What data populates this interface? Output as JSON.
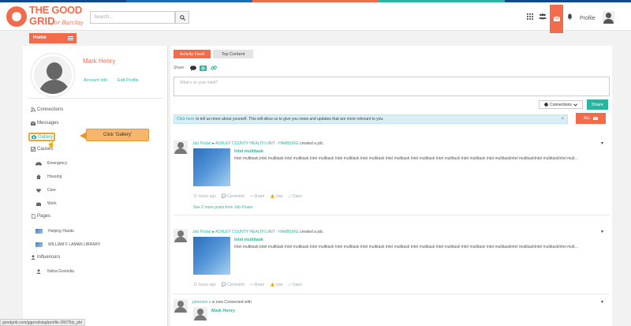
{
  "colors": {
    "brand": "#f26b4a",
    "accent": "#2bb5a0",
    "stripe": [
      "#0e4a8a",
      "#1d6bb3",
      "#f26b4a",
      "#2bb5a0",
      "#0e4a8a"
    ]
  },
  "logo": {
    "line1": "THE GOOD",
    "line2": "GRID",
    "tagline": "for Barclay"
  },
  "search": {
    "placeholder": "Search...",
    "icon": "search-icon"
  },
  "header": {
    "icons": [
      "grid-icon",
      "users-icon",
      "envelope-icon",
      "bell-icon"
    ],
    "profile_label": "Profile"
  },
  "home": {
    "label": "Home"
  },
  "sidebar": {
    "name": "Mark Henry",
    "account_info": "Account Info",
    "edit_profile": "Edit Profile",
    "connections": "Connections",
    "messages": "Messages",
    "gallery": "Gallery",
    "causes": "Causes",
    "cause_items": [
      {
        "label": "Emergency",
        "icon": "car-icon"
      },
      {
        "label": "Housing",
        "icon": "home-icon"
      },
      {
        "label": "Care",
        "icon": "heart-icon"
      },
      {
        "label": "Work",
        "icon": "briefcase-icon"
      }
    ],
    "pages": "Pages",
    "page_items": [
      "Helping Hands",
      "WILLIAM F LAMAN LIBRARY"
    ],
    "influencers": "Influencers",
    "influencer_items": [
      "Nisha Govindia"
    ]
  },
  "callout": {
    "text": "Click 'Gallery'"
  },
  "tabs": {
    "activity": "Activity Feed",
    "top": "Top Content"
  },
  "composer": {
    "share_label": "Share :",
    "placeholder": "What's on your mind?",
    "connections_btn": "Connections",
    "share_btn": "Share"
  },
  "notice": {
    "link": "Click here",
    "text": "to tell us more about yourself. This will allow us to give you news and updates that are more relevant to you.",
    "close": "×"
  },
  "filter": {
    "label": "ALL"
  },
  "posts": [
    {
      "author": "Job Poster",
      "arrow": "▸",
      "org": "ASHLEY COUNTY HEALTH UNIT - HAMBURG",
      "action": "created a job.",
      "title": "Intel multitask",
      "text": "Intel multitask,Intel multitask Intel multitask Intel multitask Intel multitask Intel multitask Intel multitask Intel multitask Intel multitask Intel multitask Intel multitaskIntel multitaskIntel multitaskIntel mult...",
      "time": "11 hours ago",
      "actions": [
        "Comment",
        "Share",
        "Like",
        "Open"
      ],
      "more": "See 2 more posts from Job Poster"
    },
    {
      "author": "Job Poster",
      "arrow": "▸",
      "org": "ASHLEY COUNTY HEALTH UNIT - HAMBURG",
      "action": "created a job.",
      "title": "Intel multitask",
      "text": "Intel multitask,Intel multitask Intel multitask Intel multitask Intel multitask Intel multitask Intel multitask Intel multitask Intel multitask Intel multitask Intel multitaskIntel multitaskIntel multitaskIntel mult...",
      "time": "11 hours ago",
      "actions": [
        "Comment",
        "Share",
        "Like",
        "Open"
      ]
    },
    {
      "author": "peterson s",
      "action": "is now Connected with",
      "title": "Mark Henry"
    }
  ],
  "statusbar": {
    "url": "goodgrid.com/ggprodstag/profile-28075/p_pb/"
  }
}
